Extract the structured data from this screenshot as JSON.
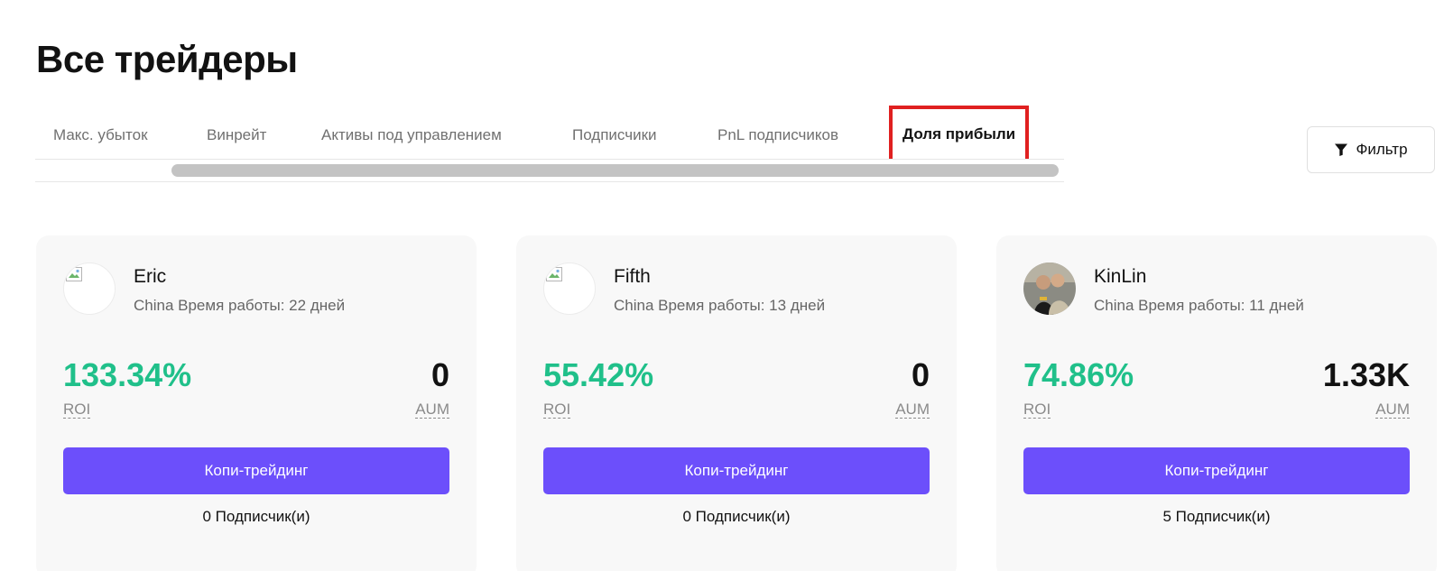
{
  "page_title": "Все трейдеры",
  "tabs": [
    {
      "label": "Макс. убыток"
    },
    {
      "label": "Винрейт"
    },
    {
      "label": "Активы под управлением"
    },
    {
      "label": "Подписчики"
    },
    {
      "label": "PnL подписчиков"
    },
    {
      "label": "Доля прибыли",
      "active": true
    }
  ],
  "filter": {
    "label": "Фильтр",
    "icon": "funnel-icon"
  },
  "labels": {
    "roi": "ROI",
    "aum": "AUM",
    "copy_button": "Копи-трейдинг"
  },
  "traders": [
    {
      "name": "Eric",
      "meta": "China Время работы: 22 дней",
      "roi": "133.34%",
      "aum": "0",
      "subscribers": "0 Подписчик(и)"
    },
    {
      "name": "Fifth",
      "meta": "China Время работы: 13 дней",
      "roi": "55.42%",
      "aum": "0",
      "subscribers": "0 Подписчик(и)"
    },
    {
      "name": "KinLin",
      "meta": "China Время работы: 11 дней",
      "roi": "74.86%",
      "aum": "1.33K",
      "subscribers": "5 Подписчик(и)"
    }
  ],
  "colors": {
    "accent": "#6c4ffb",
    "positive": "#20c08a",
    "highlight": "#e02020"
  }
}
